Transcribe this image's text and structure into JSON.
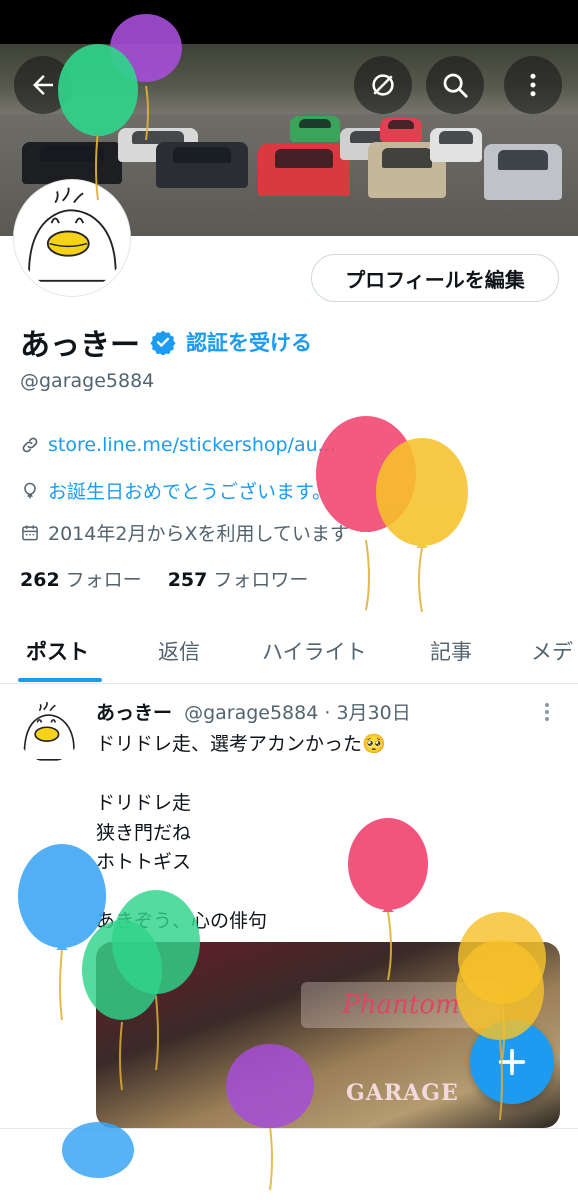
{
  "colors": {
    "accent": "#1d9bf0",
    "text_primary": "#0f1419",
    "text_secondary": "#536471"
  },
  "header": {
    "back_icon": "arrow-left-icon",
    "actions": [
      "no-notifications-icon",
      "search-icon",
      "more-vertical-icon"
    ]
  },
  "profile": {
    "edit_button_label": "プロフィールを編集",
    "display_name": "あっきー",
    "verify_link": "認証を受ける",
    "handle": "@garage5884",
    "website": "store.line.me/stickershop/au...",
    "location": "お誕生日おめでとうございます。",
    "joined": "2014年2月からXを利用しています",
    "following_count": "262",
    "following_label": "フォロー",
    "followers_count": "257",
    "followers_label": "フォロワー"
  },
  "tabs": [
    "ポスト",
    "返信",
    "ハイライト",
    "記事",
    "メデ"
  ],
  "post": {
    "author": "あっきー",
    "handle": "@garage5884",
    "separator": "·",
    "date": "3月30日",
    "text": "ドリドレ走、選考アカンかった🥺\n\nドリドレ走\n狭き門だね\nホトトギス\n\nあきぞう、心の俳句",
    "media_plate": "Phantom",
    "media_sign": "GARAGE"
  },
  "balloon_colors": [
    "#2fd48a",
    "#a64ed8",
    "#f0436e",
    "#f6c22a",
    "#3aa4f5"
  ]
}
